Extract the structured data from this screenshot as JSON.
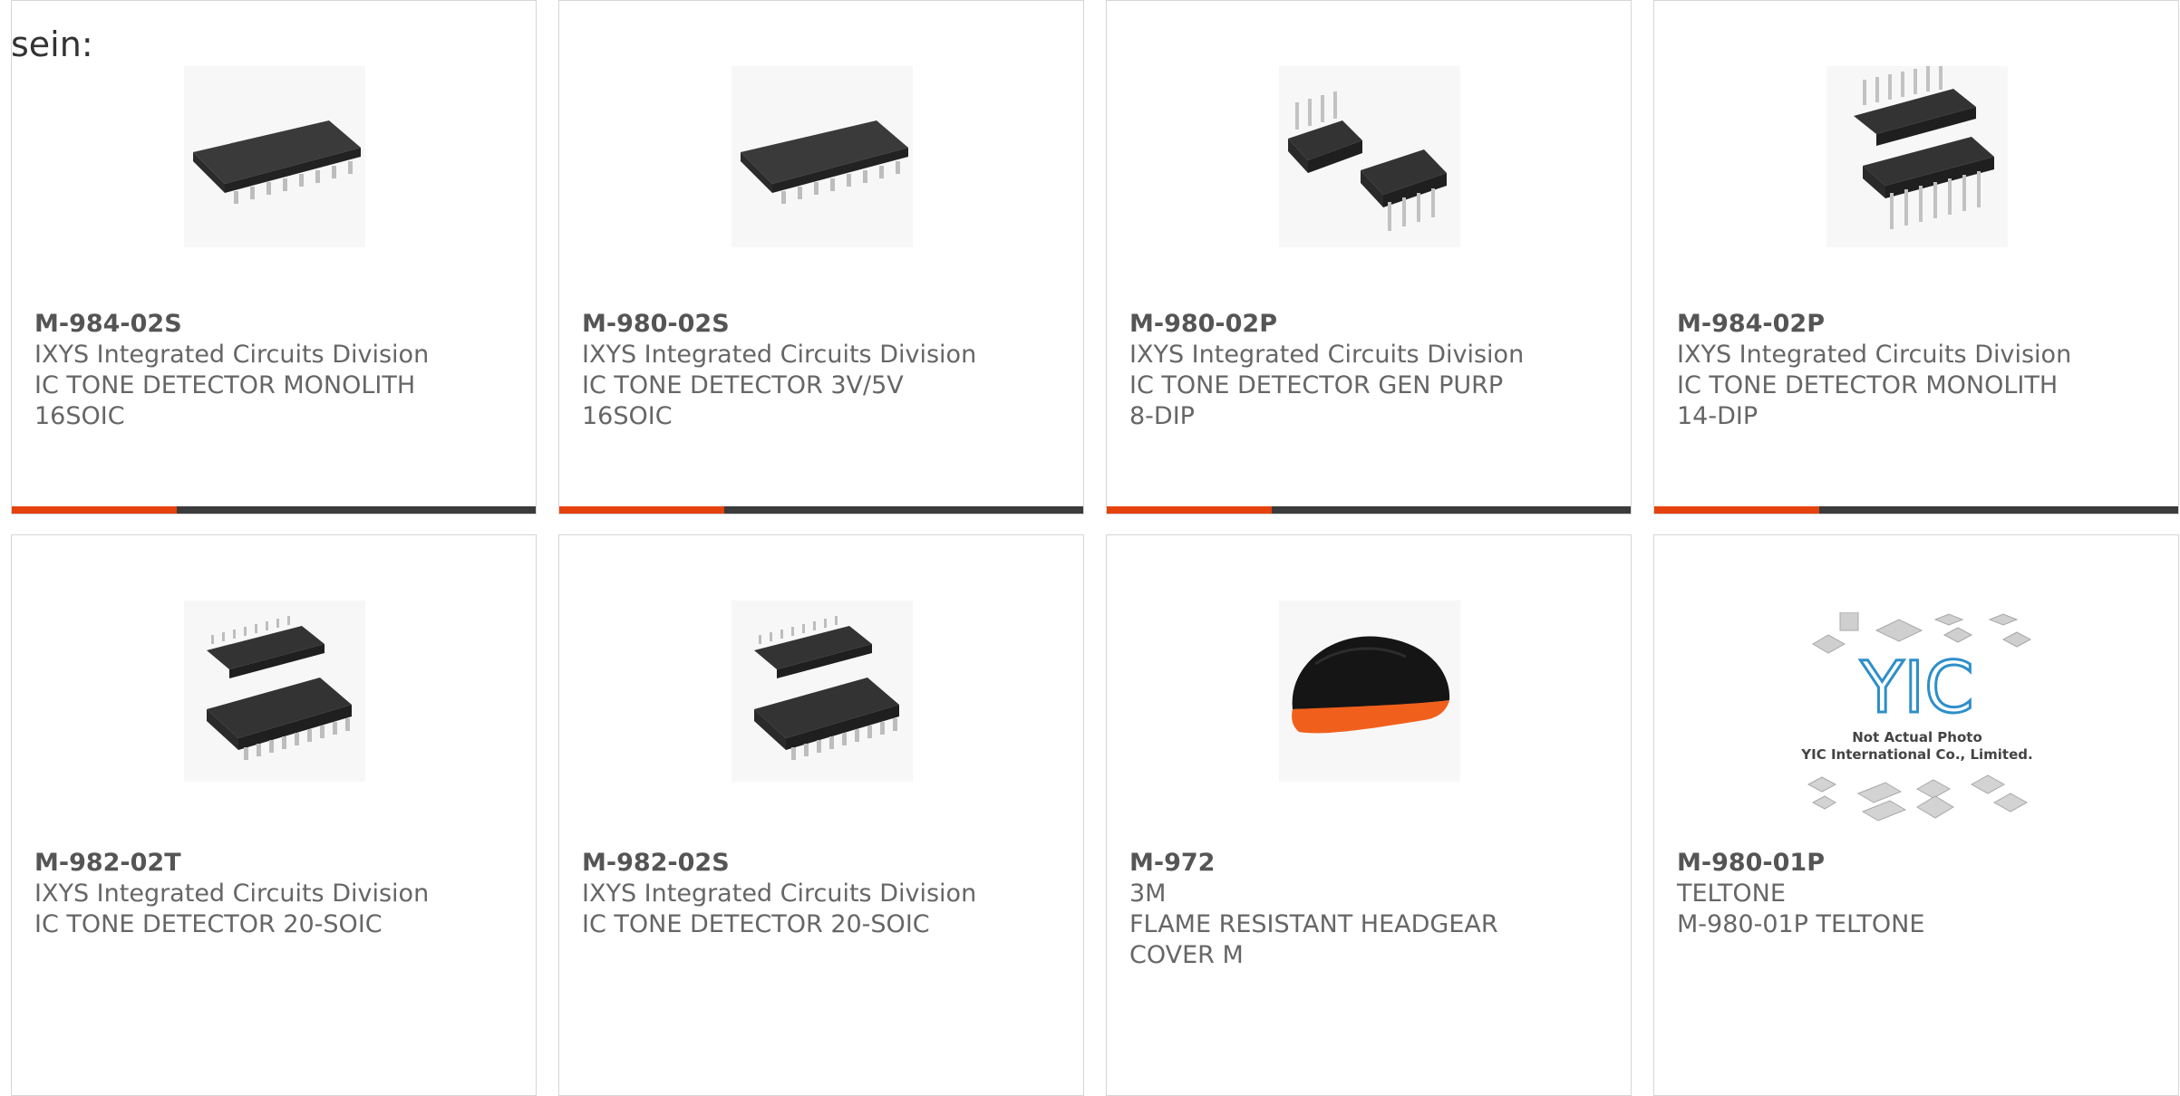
{
  "lead_text": "sein:",
  "colors": {
    "accent": "#e5420d",
    "bar": "#3b3b3b",
    "border": "#d6d6d6",
    "text": "#666666"
  },
  "products": [
    {
      "pn": "M-984-02S",
      "mfr": "IXYS Integrated Circuits Division",
      "desc1": "IC TONE DETECTOR MONOLITH",
      "desc2": "16SOIC",
      "image": "soic-chip-icon"
    },
    {
      "pn": "M-980-02S",
      "mfr": "IXYS Integrated Circuits Division",
      "desc1": "IC TONE DETECTOR 3V/5V",
      "desc2": "16SOIC",
      "image": "soic-chip-icon"
    },
    {
      "pn": "M-980-02P",
      "mfr": "IXYS Integrated Circuits Division",
      "desc1": "IC TONE DETECTOR GEN PURP",
      "desc2": "8-DIP",
      "image": "dip8-chip-icon"
    },
    {
      "pn": "M-984-02P",
      "mfr": "IXYS Integrated Circuits Division",
      "desc1": "IC TONE DETECTOR MONOLITH",
      "desc2": "14-DIP",
      "image": "dip14-chip-icon"
    },
    {
      "pn": "M-982-02T",
      "mfr": "IXYS Integrated Circuits Division",
      "desc1": "IC TONE DETECTOR 20-SOIC",
      "desc2": "",
      "image": "soic20-chip-icon"
    },
    {
      "pn": "M-982-02S",
      "mfr": "IXYS Integrated Circuits Division",
      "desc1": "IC TONE DETECTOR 20-SOIC",
      "desc2": "",
      "image": "soic20-chip-icon"
    },
    {
      "pn": "M-972",
      "mfr": "3M",
      "desc1": "FLAME RESISTANT HEADGEAR",
      "desc2": "COVER M",
      "image": "headgear-icon"
    },
    {
      "pn": "M-980-01P",
      "mfr": "TELTONE",
      "desc1": "M-980-01P TELTONE",
      "desc2": "",
      "image": "placeholder-logo-icon",
      "placeholder_logo": "YIC",
      "placeholder_line1": "Not Actual Photo",
      "placeholder_line2": "YIC International Co., Limited."
    }
  ]
}
